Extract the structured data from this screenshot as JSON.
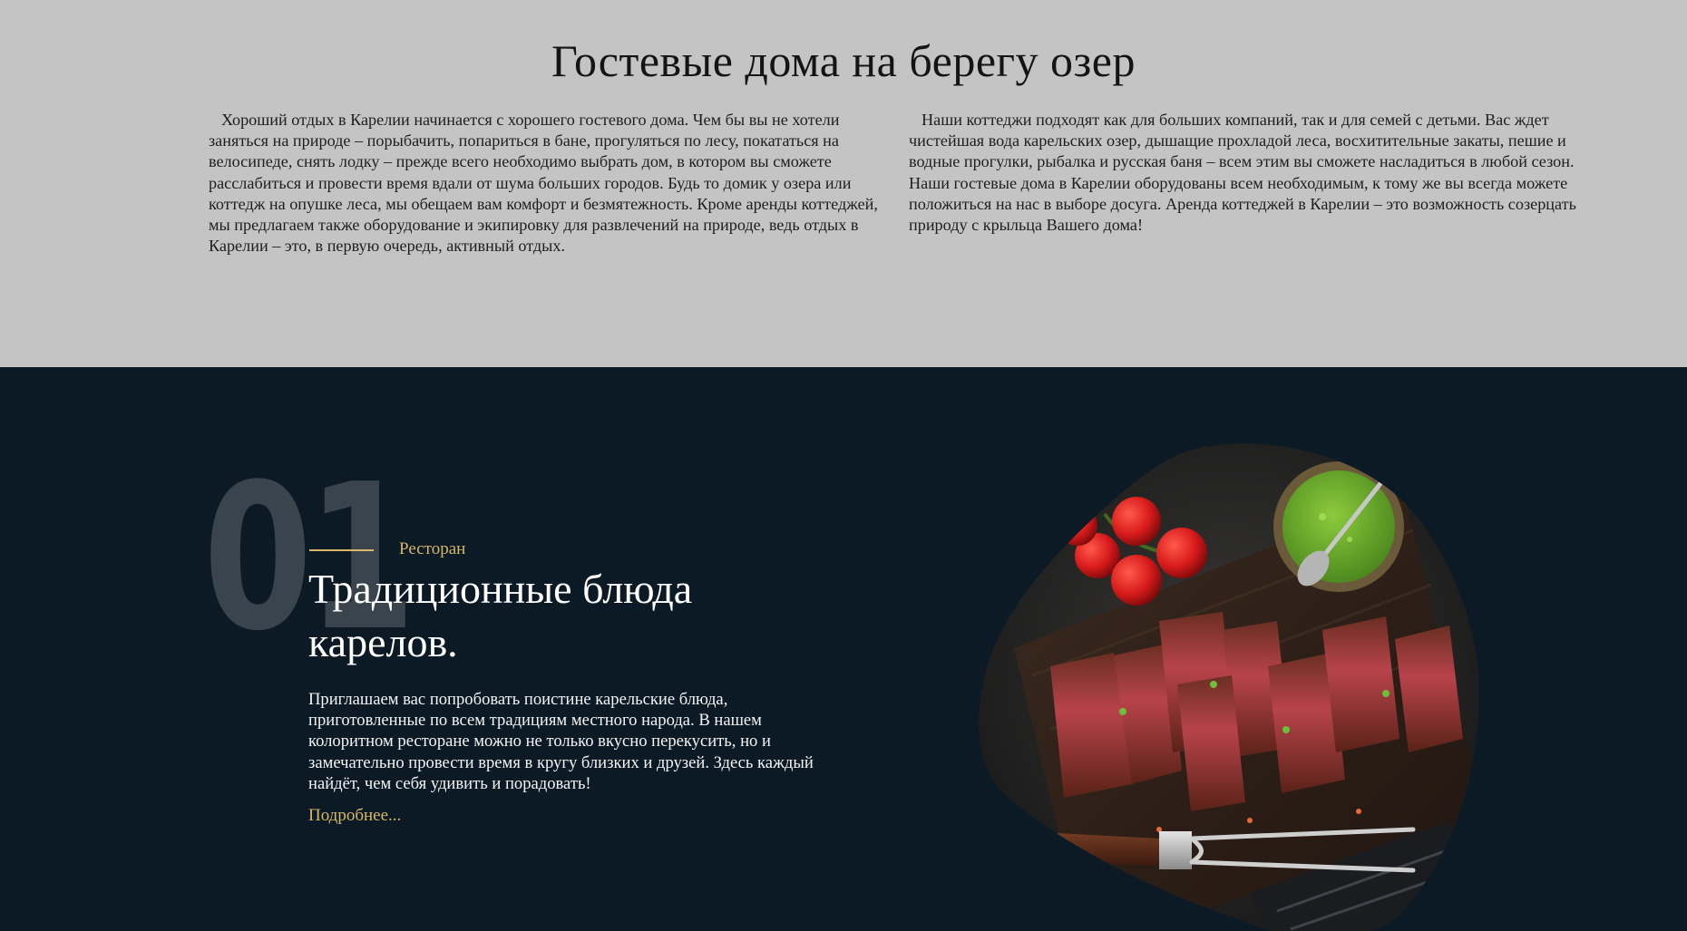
{
  "top": {
    "title": "Гостевые дома на берегу озер",
    "para_left": "Хороший отдых в Карелии начинается с хорошего гостевого дома. Чем бы вы не хотели заняться на природе – порыбачить, попариться в бане, прогуляться по лесу, покататься на велосипеде, снять лодку – прежде всего необходимо выбрать дом, в котором вы сможете расслабиться и провести время вдали от шума больших городов. Будь то домик у озера или коттедж на опушке леса, мы обещаем вам комфорт и безмятежность. Кроме аренды коттеджей, мы предлагаем также оборудование и экипировку для развлечений на природе, ведь отдых в Карелии – это, в первую очередь, активный отдых.",
    "para_right": "Наши коттеджи подходят как для больших компаний, так и для семей с детьми. Вас ждет чистейшая вода карельских озер, дышащие прохладой леса, восхитительные закаты, пешие и водные прогулки, рыбалка и русская баня – всем этим вы сможете насладиться в любой сезон. Наши гостевые дома в Карелии оборудованы всем необходимым, к тому же вы всегда можете положиться на нас в выборе досуга. Аренда коттеджей в Карелии – это возможность созерцать природу с крыльца Вашего дома!"
  },
  "feature": {
    "number": "01",
    "category": "Ресторан",
    "heading": "Традиционные блюда карелов.",
    "description": "Приглашаем вас попробовать поистине карельские блюда, приготовленные по всем традициям местного народа. В нашем колоритном ресторане можно не только вкусно перекусить, но и замечательно провести время в кругу близких и друзей. Здесь каждый найдёт, чем себя удивить и порадовать!",
    "link": "Подробнее..."
  },
  "colors": {
    "top_bg": "#c4c4c4",
    "bottom_bg": "#0b1a24",
    "accent": "#d7b768",
    "number_color": "#3a444c"
  }
}
